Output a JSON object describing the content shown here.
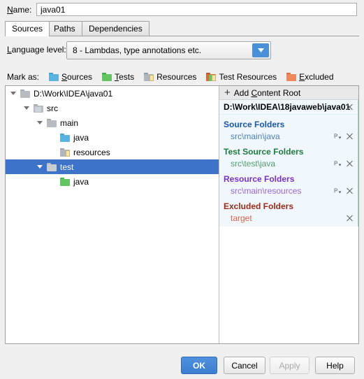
{
  "window": {
    "name_label": "Name:",
    "name_value": "java01"
  },
  "tabs": [
    {
      "label": "Sources",
      "active": true
    },
    {
      "label": "Paths",
      "active": false
    },
    {
      "label": "Dependencies",
      "active": false
    }
  ],
  "language_level": {
    "label": "Language level:",
    "value": "8 - Lambdas, type annotations etc.",
    "arrow_color": "#4a90d9"
  },
  "mark_as": {
    "label": "Mark as:",
    "items": [
      {
        "label": "Sources",
        "icon": "folder-sources-icon",
        "color": "#5bb3e0"
      },
      {
        "label": "Tests",
        "icon": "folder-tests-icon",
        "color": "#62c462"
      },
      {
        "label": "Resources",
        "icon": "folder-resources-icon",
        "color": "#b0b6bd"
      },
      {
        "label": "Test Resources",
        "icon": "folder-test-resources-icon",
        "color": "#b0b6bd"
      },
      {
        "label": "Excluded",
        "icon": "folder-excluded-icon",
        "color": "#f0885a"
      }
    ]
  },
  "tree": {
    "rows": [
      {
        "label": "D:\\Work\\IDEA\\java01",
        "depth": 0,
        "arrow": "expanded",
        "icon": "folder-plain-icon",
        "color": "#b6bcc2",
        "selected": false
      },
      {
        "label": "src",
        "depth": 1,
        "arrow": "expanded",
        "icon": "folder-module-icon",
        "color": "#b6bcc2",
        "selected": false
      },
      {
        "label": "main",
        "depth": 2,
        "arrow": "expanded",
        "icon": "folder-plain-icon",
        "color": "#b6bcc2",
        "selected": false
      },
      {
        "label": "java",
        "depth": 3,
        "arrow": "none",
        "icon": "folder-sources-icon",
        "color": "#5bb3e0",
        "selected": false
      },
      {
        "label": "resources",
        "depth": 3,
        "arrow": "none",
        "icon": "folder-resources-icon",
        "color": "#b0b6bd",
        "selected": false
      },
      {
        "label": "test",
        "depth": 2,
        "arrow": "expanded",
        "icon": "folder-plain-icon",
        "color": "#c9cdd1",
        "selected": true
      },
      {
        "label": "java",
        "depth": 3,
        "arrow": "none",
        "icon": "folder-tests-icon",
        "color": "#62c462",
        "selected": false
      }
    ],
    "selection_color": "#3d74c9"
  },
  "content_roots": {
    "add_button": "Add Content Root",
    "root_path": "D:\\Work\\IDEA\\18javaweb\\java01",
    "groups": [
      {
        "header": "Source Folders",
        "header_color": "#1a56a8",
        "path_color": "#4a7fbe",
        "entries": [
          {
            "path": "src\\main\\java",
            "has_prefix_button": true
          }
        ]
      },
      {
        "header": "Test Source Folders",
        "header_color": "#1f7a3d",
        "path_color": "#4f9e6a",
        "entries": [
          {
            "path": "src\\test\\java",
            "has_prefix_button": true
          }
        ]
      },
      {
        "header": "Resource Folders",
        "header_color": "#7b31c4",
        "path_color": "#9a63d6",
        "entries": [
          {
            "path": "src\\main\\resources",
            "has_prefix_button": true
          }
        ]
      },
      {
        "header": "Excluded Folders",
        "header_color": "#9b2a17",
        "path_color": "#e0604a",
        "entries": [
          {
            "path": "target",
            "has_prefix_button": false
          }
        ]
      }
    ]
  },
  "buttons": {
    "ok": "OK",
    "cancel": "Cancel",
    "apply": "Apply",
    "help": "Help"
  }
}
